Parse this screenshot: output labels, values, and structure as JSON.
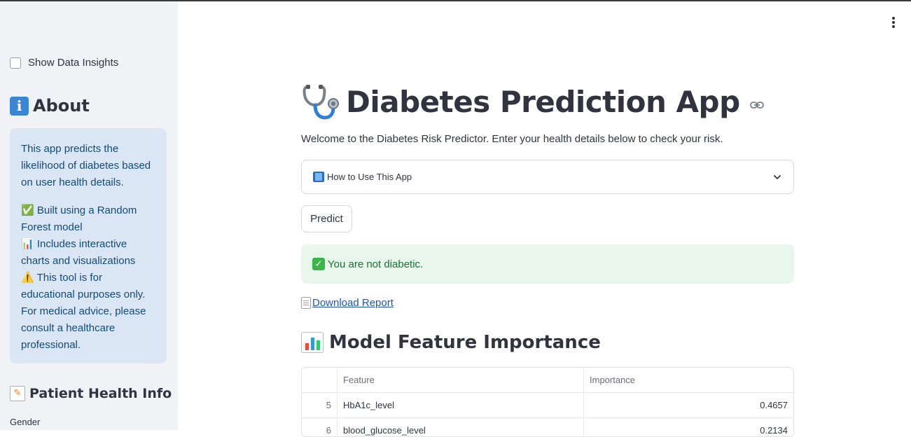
{
  "sidebar": {
    "show_insights_label": "Show Data Insights",
    "about_heading": "About",
    "about_icon": "info-icon",
    "info_paragraph": "This app predicts the likelihood of diabetes based on user health details.",
    "info_lines": [
      "✅ Built using a Random Forest model",
      "📊 Includes interactive charts and visualizations",
      "⚠️ This tool is for educational purposes only. For medical advice, please consult a healthcare professional."
    ],
    "patient_heading": "Patient Health Info",
    "patient_icon": "memo-icon",
    "gender_label": "Gender"
  },
  "main": {
    "title": "Diabetes Prediction App",
    "title_icon": "stethoscope-icon",
    "welcome": "Welcome to the Diabetes Risk Predictor. Enter your health details below to check your risk.",
    "expander_label": "How to Use This App",
    "predict_label": "Predict",
    "result": "You are not diabetic.",
    "download_label": "Download Report",
    "section_heading": "Model Feature Importance",
    "table": {
      "headers": [
        "",
        "Feature",
        "Importance"
      ],
      "rows": [
        [
          "5",
          "HbA1c_level",
          "0.4657"
        ],
        [
          "6",
          "blood_glucose_level",
          "0.2134"
        ]
      ]
    }
  },
  "colors": {
    "sidebar_bg": "#f0f2f6",
    "info_bg": "#dbe6f4",
    "info_text": "#114a7c",
    "success_bg": "#e8f6ec",
    "success_text": "#177233",
    "link": "#1a55c4"
  }
}
